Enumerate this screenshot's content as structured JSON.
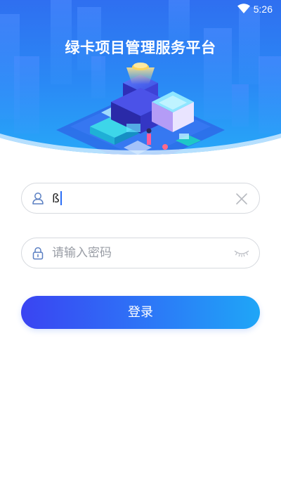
{
  "status_bar": {
    "time": "5:26",
    "wifi_icon": "wifi-icon"
  },
  "header": {
    "title": "绿卡项目管理服务平台"
  },
  "login_form": {
    "username": {
      "value": "ß",
      "icon": "user-icon",
      "clear_icon": "close-icon"
    },
    "password": {
      "placeholder": "请输入密码",
      "icon": "lock-icon",
      "toggle_icon": "eye-closed-icon"
    },
    "submit_label": "登录"
  },
  "colors": {
    "banner_top": "#2f6ff0",
    "banner_bottom": "#27a8f8",
    "button_start": "#3a44f2",
    "button_end": "#1fa6f7",
    "field_border": "#d6d9de"
  }
}
